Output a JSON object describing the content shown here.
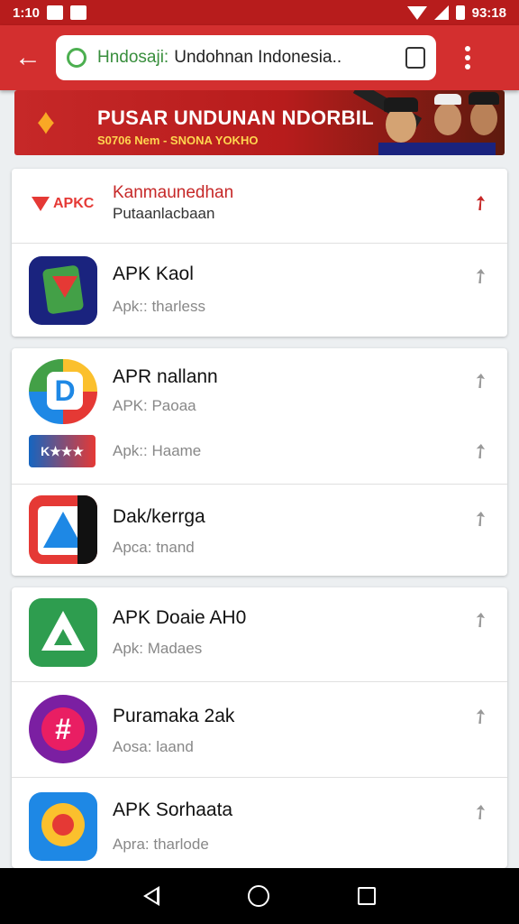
{
  "status_bar": {
    "time_left": "1:10",
    "time_right": "93:18"
  },
  "toolbar": {
    "url_site": "Hndosaji:",
    "url_title": "Undohnan Indonesia..",
    "tabs_count": ""
  },
  "banner": {
    "title": "PUSAR UNDUNAN NDORBIL",
    "subtitle": "S0706 Nem - SNONA YOKHO"
  },
  "cards": [
    {
      "rows": [
        {
          "title": "Kanmaunedhan",
          "subtitle": "Putaanlacbaan",
          "icon": "apk-logo-icon",
          "icon_label": "APKC"
        },
        {
          "title": "APK Kaol",
          "subtitle": "Apk:: tharless",
          "icon": "shield-phone-icon"
        }
      ]
    },
    {
      "rows": [
        {
          "title": "APR nallann",
          "subtitle": "APK: Paoaa",
          "icon": "d-chat-icon"
        },
        {
          "title": "",
          "subtitle": "Apk:: Haame",
          "icon": "k-badge-icon"
        },
        {
          "title": "Dak/kerrga",
          "subtitle": "Apca: tnand",
          "icon": "triangle-icon"
        }
      ]
    },
    {
      "rows": [
        {
          "title": "APK Doaie AH0",
          "subtitle": "Apk: Madaes",
          "icon": "green-triangle-icon"
        },
        {
          "title": "Puramaka 2ak",
          "subtitle": "Aosa: laand",
          "icon": "hash-circle-icon"
        },
        {
          "title": "APK Sorhaata",
          "subtitle": "Apra: tharlode",
          "icon": "sun-bubble-icon"
        }
      ]
    }
  ],
  "colors": {
    "primary": "#d32f2f",
    "status": "#b71c1c",
    "accent": "#4caf50"
  }
}
